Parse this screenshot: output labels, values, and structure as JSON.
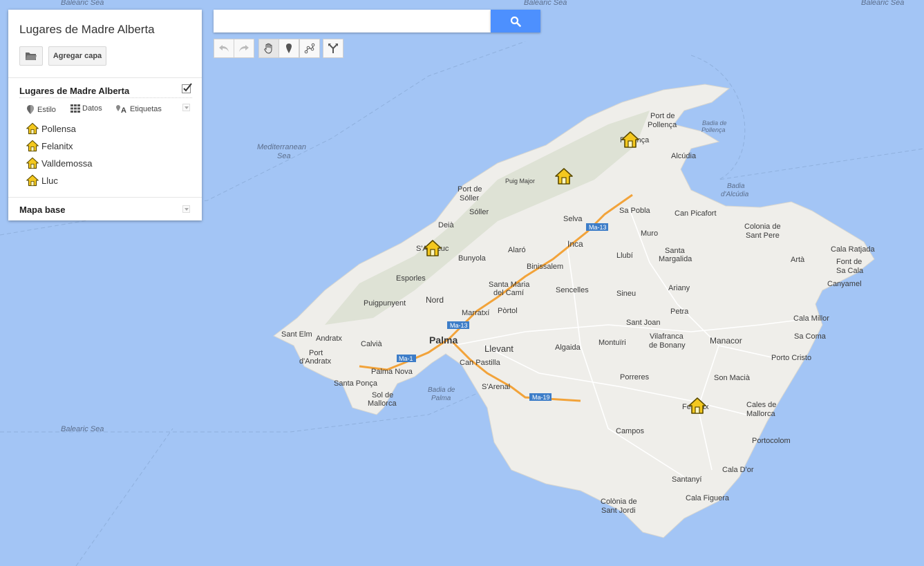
{
  "panel": {
    "map_title": "Lugares de Madre Alberta",
    "add_layer_label": "Agregar capa",
    "layer": {
      "name": "Lugares de Madre Alberta",
      "checked": true,
      "tools": {
        "style": "Estilo",
        "data": "Datos",
        "labels": "Etiquetas"
      },
      "places": [
        "Pollensa",
        "Felanitx",
        "Valldemossa",
        "Lluc"
      ]
    },
    "base_map_label": "Mapa base"
  },
  "search": {
    "value": "",
    "placeholder": ""
  },
  "colors": {
    "water": "#a3c5f5",
    "land": "#efeeea",
    "highway": "#f2a33a",
    "search_button": "#4d90fe",
    "marker": "#f4c81e"
  },
  "toolbar": [
    "undo-icon",
    "redo-icon",
    "hand-icon",
    "marker-icon",
    "draw-line-icon",
    "directions-icon"
  ],
  "map_labels": {
    "balearic_sea_tl": "Balearic Sea",
    "balearic_sea_tc": "Balearic Sea",
    "balearic_sea_tr": "Balearic Sea",
    "balearic_sea_bl": "Balearic Sea",
    "mediterranean_1": "Mediterranean",
    "mediterranean_2": "Sea",
    "port_de_pollenca_1": "Port de",
    "port_de_pollenca_2": "Pollença",
    "pollenca": "Pollença",
    "badia_pollenca_1": "Badia de",
    "badia_pollenca_2": "Pollença",
    "alcudia": "Alcúdia",
    "badia_alcudia_1": "Badia",
    "badia_alcudia_2": "d'Alcúdia",
    "puig_major": "Puig Major",
    "port_de_soller_1": "Port de",
    "port_de_soller_2": "Sóller",
    "soller": "Sóller",
    "deia": "Deià",
    "sa_pobla": "Sa Pobla",
    "can_picafort": "Can Picafort",
    "selva": "Selva",
    "colonia_1": "Colonia de",
    "colonia_2": "Sant Pere",
    "valldemossa": "S'Arracuc",
    "inca": "Inca",
    "muro": "Muro",
    "cala_ratjada": "Cala Ratjada",
    "alaro": "Alaró",
    "bunyola": "Bunyola",
    "llubi": "Llubí",
    "santa_margalida_1": "Santa",
    "santa_margalida_2": "Margalida",
    "arta": "Artà",
    "font_1": "Font de",
    "font_2": "Sa Cala",
    "binissalem": "Binissalem",
    "canyamel": "Canyamel",
    "esporles": "Esporles",
    "santa_maria_1": "Santa Maria",
    "santa_maria_2": "del Camí",
    "sencelles": "Sencelles",
    "ariany": "Ariany",
    "puigpunyent": "Puigpunyent",
    "nord": "Nord",
    "sineu": "Sineu",
    "marratxi": "Marratxí",
    "portol": "Pòrtol",
    "petra": "Petra",
    "cala_millor": "Cala Millor",
    "sant_elm": "Sant Elm",
    "andratx": "Andratx",
    "calvia": "Calvià",
    "palma": "Palma",
    "sant_joan": "Sant Joan",
    "vilafranca_1": "Vilafranca",
    "vilafranca_2": "de Bonany",
    "sa_coma": "Sa Coma",
    "llevant": "Llevant",
    "manacor": "Manacor",
    "algaida": "Algaida",
    "montuiri": "Montuïri",
    "port_andratx_1": "Port",
    "port_andratx_2": "d'Andratx",
    "can_pastilla": "Can Pastilla",
    "porto_cristo": "Porto Cristo",
    "palma_nova": "Palma Nova",
    "santa_ponca": "Santa Ponça",
    "son_macia": "Son Macià",
    "sarenal": "S'Arenal",
    "porreres": "Porreres",
    "badia_palma_1": "Badia de",
    "badia_palma_2": "Palma",
    "sol_1": "Sol de",
    "sol_2": "Mallorca",
    "felanitx": "Felanitx",
    "cales_1": "Cales de",
    "cales_2": "Mallorca",
    "campos": "Campos",
    "portocolom": "Portocolom",
    "cala_dor": "Cala D'or",
    "santanyi": "Santanyí",
    "cala_figuera": "Cala Figuera",
    "colonia_sj_1": "Colònia de",
    "colonia_sj_2": "Sant Jordi",
    "shield_ma13a": "Ma-13",
    "shield_ma13b": "Ma-13",
    "shield_ma1": "Ma-1",
    "shield_ma19": "Ma-19"
  }
}
